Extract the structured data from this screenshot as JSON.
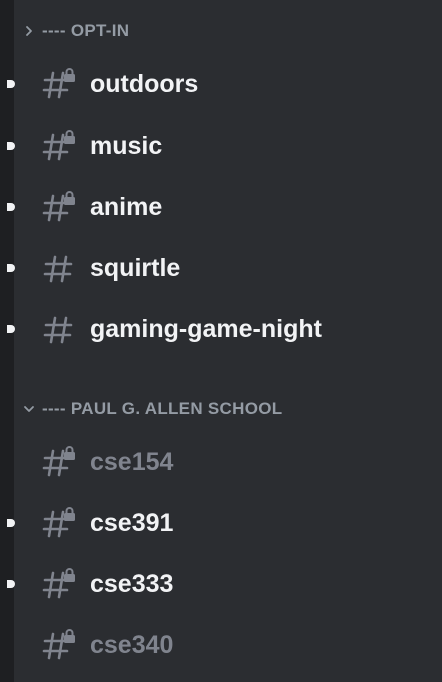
{
  "colors": {
    "background": "#2b2d31",
    "server_strip": "#1e1f22",
    "unread_text": "#f2f3f5",
    "read_text": "#80848e",
    "category_text": "#949ba4",
    "icon": "#80848e"
  },
  "categories": [
    {
      "label": "---- OPT-IN",
      "collapsed": true,
      "chevron_icon": "chevron-right-icon",
      "channels": [
        {
          "name": "outdoors",
          "locked": true,
          "unread": true
        },
        {
          "name": "music",
          "locked": true,
          "unread": true
        },
        {
          "name": "anime",
          "locked": true,
          "unread": true
        },
        {
          "name": "squirtle",
          "locked": false,
          "unread": true
        },
        {
          "name": "gaming-game-night",
          "locked": false,
          "unread": true
        }
      ]
    },
    {
      "label": "---- PAUL G. ALLEN SCHOOL",
      "collapsed": false,
      "chevron_icon": "chevron-down-icon",
      "channels": [
        {
          "name": "cse154",
          "locked": true,
          "unread": false
        },
        {
          "name": "cse391",
          "locked": true,
          "unread": true
        },
        {
          "name": "cse333",
          "locked": true,
          "unread": true
        },
        {
          "name": "cse340",
          "locked": true,
          "unread": false
        }
      ]
    }
  ]
}
